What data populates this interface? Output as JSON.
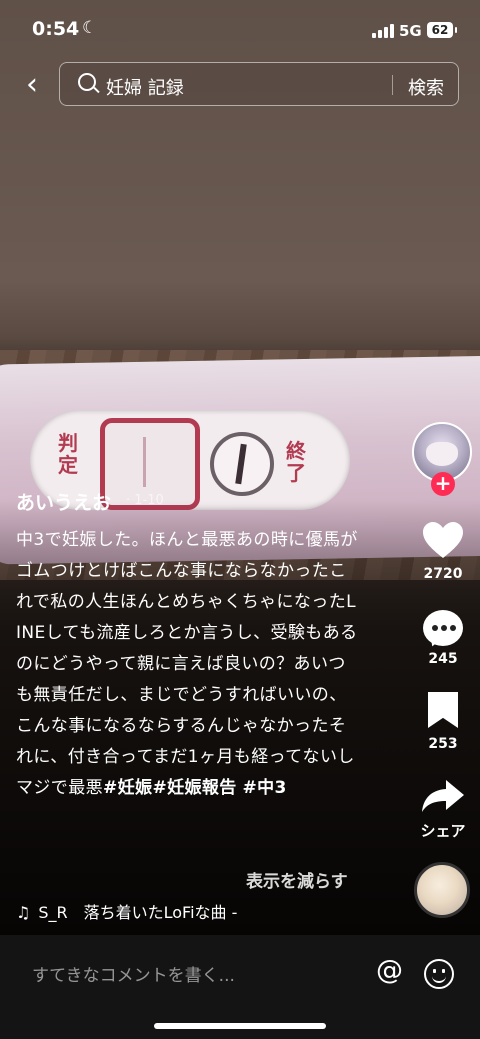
{
  "status_bar": {
    "time": "0:54",
    "network": "5G",
    "battery": "62"
  },
  "search": {
    "query": "妊婦 記録",
    "button": "検索"
  },
  "video": {
    "label_judge": "判定",
    "label_end": "終了"
  },
  "post": {
    "username": "あいうえお",
    "date": "· 1-10",
    "caption_text": "中3で妊娠した。ほんと最悪あの時に優馬がゴムつけとけばこんな事にならなかったこれで私の人生ほんとめちゃくちゃになったLINEしても流産しろとか言うし、受験もあるのにどうやって親に言えば良いの？あいつも無責任だし、まじでどうすればいいの、こんな事になるならするんじゃなかったそれに、付き合ってまだ1ヶ月も経ってないしマジで最悪",
    "hashtags": [
      "#妊娠",
      "#妊娠報告",
      "#中3"
    ],
    "show_less": "表示を減らす",
    "music": "S_R　落ち着いたLoFiな曲 -"
  },
  "actions": {
    "likes": "2720",
    "comments": "245",
    "saves": "253",
    "share": "シェア"
  },
  "comment_bar": {
    "placeholder": "すてきなコメントを書く..."
  },
  "colors": {
    "accent": "#fe2c55",
    "bottom_bar": "#141414"
  }
}
